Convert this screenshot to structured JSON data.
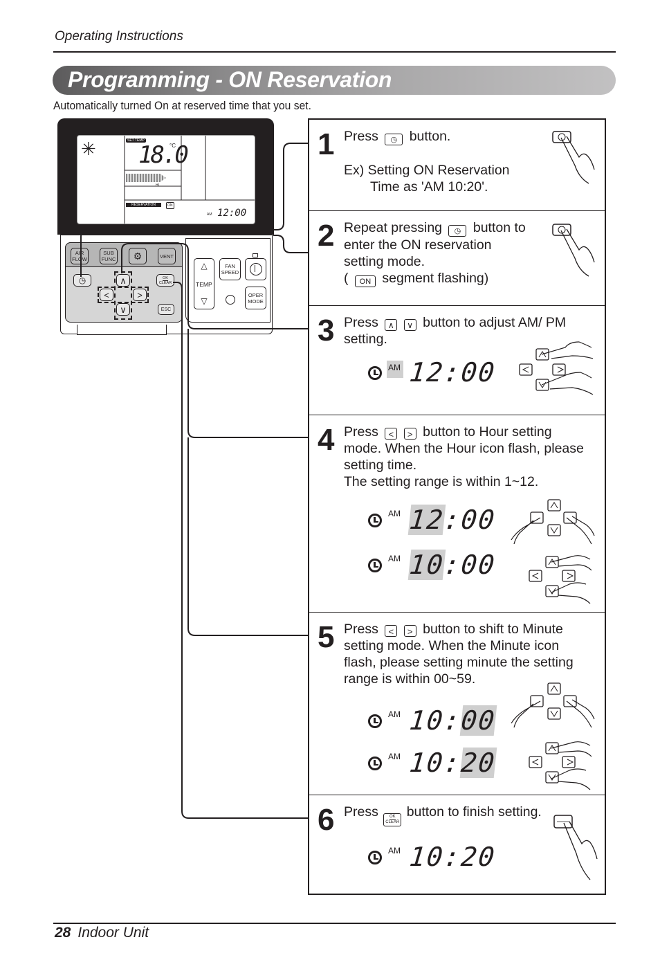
{
  "header": {
    "section": "Operating Instructions"
  },
  "title": "Programming - ON Reservation",
  "subtitle": "Automatically turned On at reserved time that you set.",
  "footer": {
    "page_number": "28",
    "label": "Indoor Unit"
  },
  "remote": {
    "lcd": {
      "set_temp_label": "SET TEMP",
      "temperature": "18.0",
      "unit": "°C",
      "fan_label": "HI",
      "reservation_label": "RESERVATION",
      "on_label": "ON",
      "am_label": "AM",
      "time": "12:00",
      "mode_icon": "snowflake-icon"
    },
    "buttons": {
      "air_flow": "AIR FLOW",
      "sub_func": "SUB FUNC",
      "settings_icon": "gear-icon",
      "vent": "VENT",
      "reservation_icon": "clock-icon",
      "up": "∧",
      "down": "∨",
      "left": "<",
      "right": ">",
      "ok": "OK",
      "clear": "CLEAR",
      "esc": "ESC",
      "temp": "TEMP",
      "temp_up": "△",
      "temp_down": "▽",
      "fan": "FAN",
      "speed": "SPEED",
      "power_icon": "power-icon",
      "oper": "OPER",
      "mode": "MODE"
    }
  },
  "steps": [
    {
      "number": "1",
      "text_a": "Press",
      "text_b": "button.",
      "example_1": "Ex) Setting ON Reservation",
      "example_2": "Time as 'AM 10:20'."
    },
    {
      "number": "2",
      "text_a": "Repeat pressing",
      "text_b": "button to",
      "line2": "enter the ON reservation",
      "line3": "setting mode.",
      "line4_a": "(",
      "on_badge": "ON",
      "line4_b": "segment flashing)"
    },
    {
      "number": "3",
      "text_a": "Press",
      "up_key": "∧",
      "down_key": "∨",
      "text_b": "button to adjust AM/ PM",
      "line2": "setting.",
      "display": {
        "am": "AM",
        "time": "12:00",
        "highlight": "am"
      }
    },
    {
      "number": "4",
      "text_a": "Press",
      "left_key": "<",
      "right_key": ">",
      "text_b": "button to Hour setting",
      "line2": "mode. When the Hour icon flash, please",
      "line3": "setting time.",
      "line4": "The setting range is within 1~12.",
      "displays": [
        {
          "am": "AM",
          "hours": "12",
          "minutes": "00",
          "highlight": "hours"
        },
        {
          "am": "AM",
          "hours": "10",
          "minutes": "00",
          "highlight": "hours"
        }
      ]
    },
    {
      "number": "5",
      "text_a": "Press",
      "left_key": "<",
      "right_key": ">",
      "text_b": "button to shift to Minute",
      "line2": "setting mode. When the Minute icon",
      "line3": "flash, please setting minute the setting",
      "line4": "range is within 00~59.",
      "displays": [
        {
          "am": "AM",
          "hours": "10",
          "minutes": "00",
          "highlight": "minutes"
        },
        {
          "am": "AM",
          "hours": "10",
          "minutes": "20",
          "highlight": "minutes"
        }
      ]
    },
    {
      "number": "6",
      "text_a": "Press",
      "ok_key_top": "OK",
      "ok_key_bottom": "CLEAR",
      "text_b": "button to finish setting.",
      "display": {
        "am": "AM",
        "time": "10:20"
      }
    }
  ]
}
